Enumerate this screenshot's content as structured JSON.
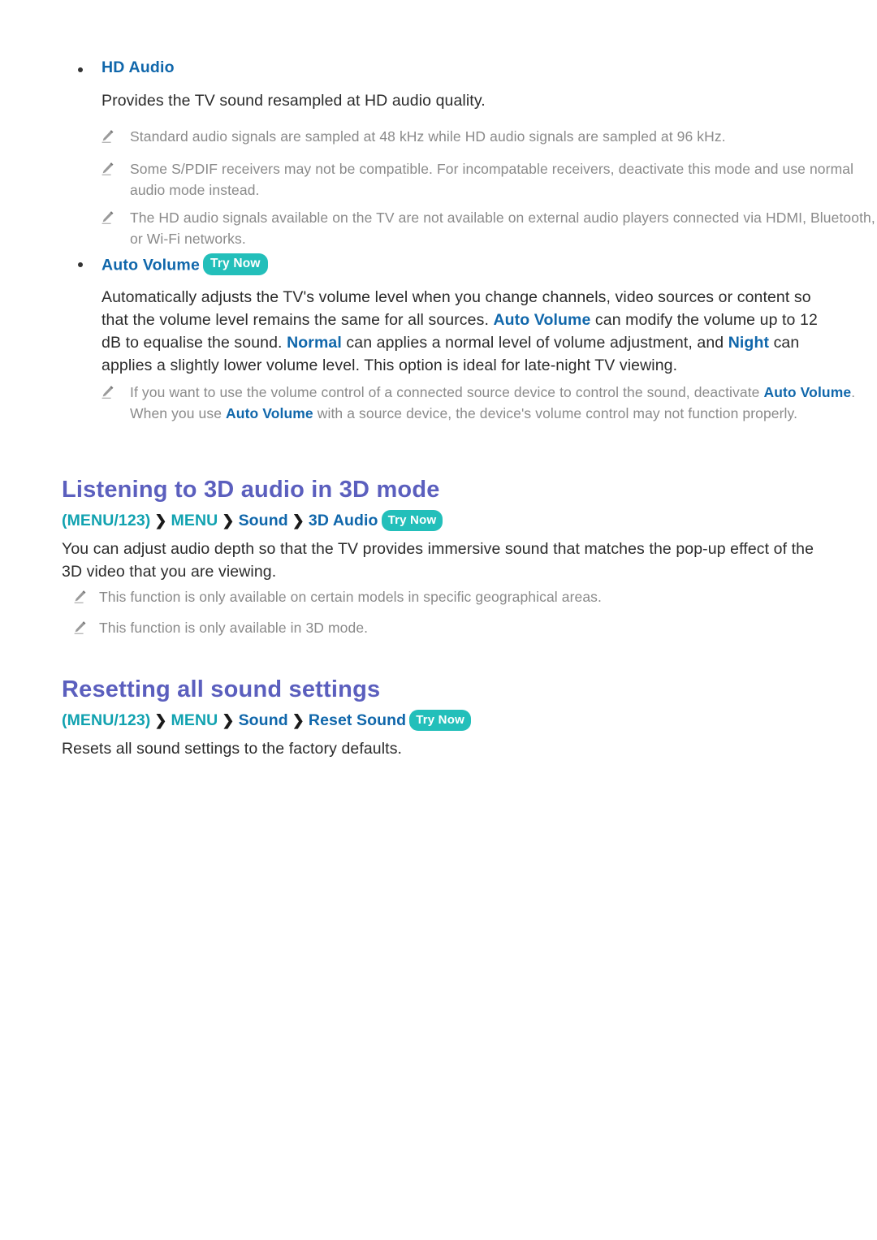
{
  "page": {
    "colors": {
      "heading": "#5b5fbe",
      "link_blue": "#1067ab",
      "breadcrumb_teal": "#11a2b0",
      "try_now_badge": "#23bfba",
      "note_grey": "#8a8a8a",
      "body": "#2b2b2b",
      "background": "#ffffff"
    },
    "try_now_label": "Try Now",
    "breadcrumb_arrow": "❯"
  },
  "hd_audio": {
    "bullet_label": "HD Audio",
    "description": "Provides the TV sound resampled at HD audio quality.",
    "notes": [
      "Standard audio signals are sampled at 48 kHz while HD audio signals are sampled at 96 kHz.",
      "Some S/PDIF receivers may not be compatible. For incompatable receivers, deactivate this mode and use normal audio mode instead.",
      "The HD audio signals available on the TV are not available on external audio players connected via HDMI, Bluetooth, or Wi-Fi networks."
    ]
  },
  "auto_volume": {
    "bullet_label": "Auto Volume",
    "try_now": "Try Now",
    "paragraph": {
      "p1": "Automatically adjusts the TV's volume level when you change channels, video sources or content so that the volume level remains the same for all sources. ",
      "term1": "Auto Volume",
      "p2": " can modify the volume up to 12 dB to equalise the sound. ",
      "term2": "Normal",
      "p3": " can applies a normal level of volume adjustment, and ",
      "term3": "Night",
      "p4": " can applies a slightly lower volume level. This option is ideal for late-night TV viewing."
    },
    "note": {
      "n1": "If you want to use the volume control of a connected source device to control the sound, deactivate ",
      "term1": "Auto Volume",
      "n2": ". When you use ",
      "term2": "Auto Volume",
      "n3": " with a source device, the device's volume control may not function properly."
    }
  },
  "section_3d_audio": {
    "heading": "Listening to 3D audio in 3D mode",
    "breadcrumb": {
      "root": "(MENU/123)",
      "items": [
        "MENU",
        "Sound",
        "3D Audio"
      ],
      "try_now": "Try Now"
    },
    "body": "You can adjust audio depth so that the TV provides immersive sound that matches the pop-up effect of the 3D video that you are viewing.",
    "notes": [
      "This function is only available on certain models in specific geographical areas.",
      "This function is only available in 3D mode."
    ]
  },
  "section_reset_sound": {
    "heading": "Resetting all sound settings",
    "breadcrumb": {
      "root": "(MENU/123)",
      "items": [
        "MENU",
        "Sound",
        "Reset Sound"
      ],
      "try_now": "Try Now"
    },
    "body": "Resets all sound settings to the factory defaults."
  }
}
